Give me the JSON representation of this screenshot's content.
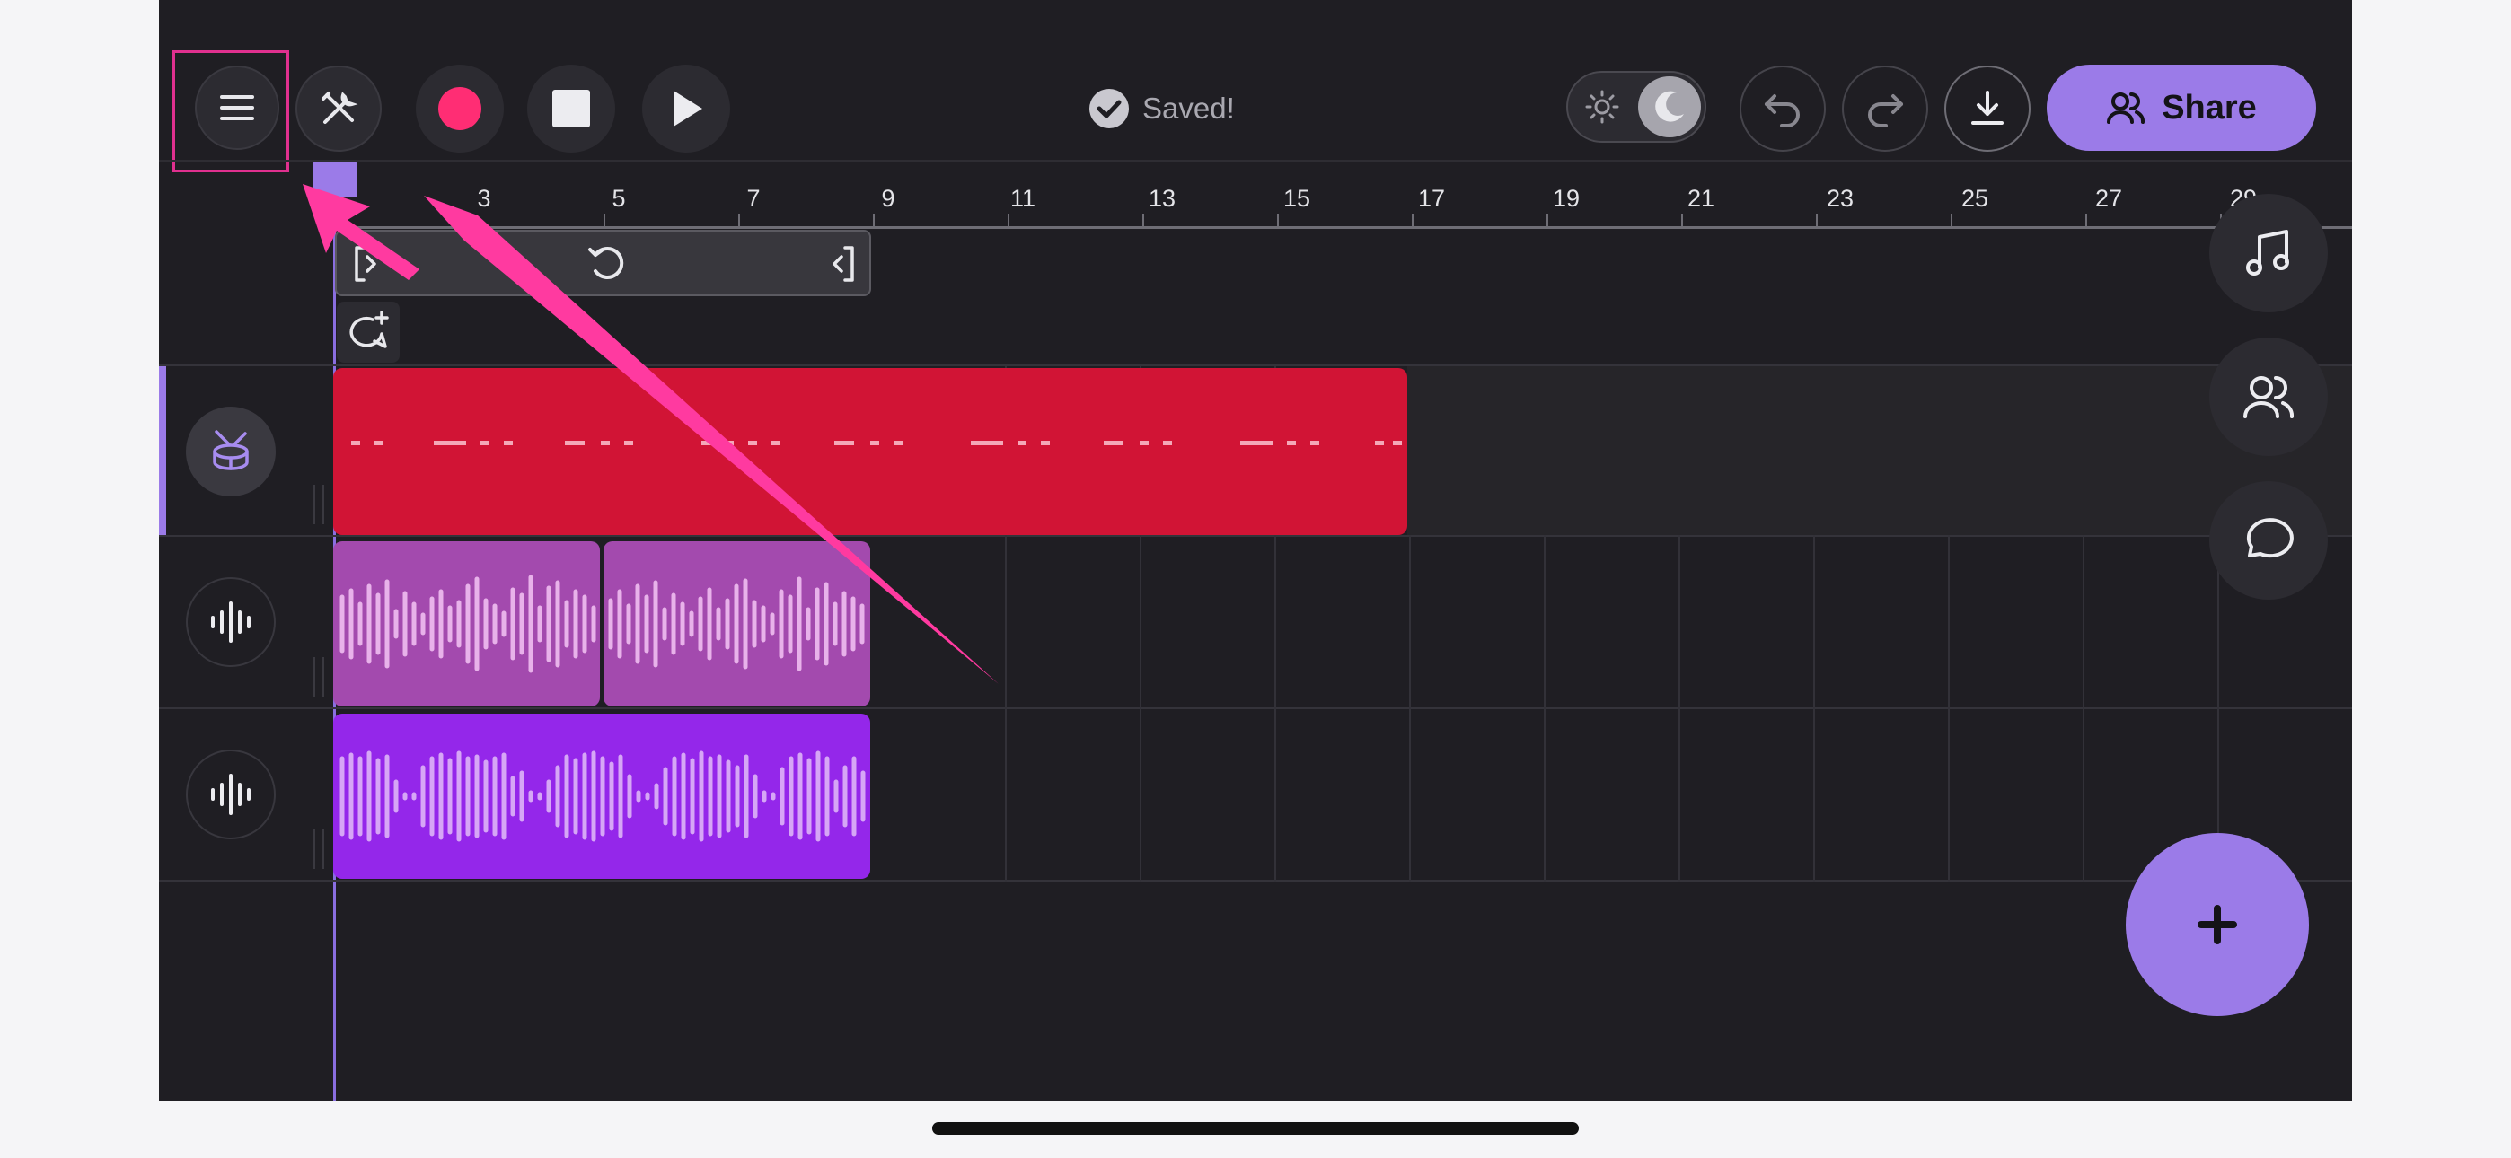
{
  "toolbar": {
    "menu_icon": "hamburger-menu-icon",
    "tools_icon": "tools-icon",
    "record_icon": "record-icon",
    "stop_icon": "stop-icon",
    "play_icon": "play-icon",
    "status": "Saved!",
    "theme_toggle": {
      "light_icon": "sun-icon",
      "dark_icon": "moon-icon",
      "selected": "dark"
    },
    "undo_icon": "undo-icon",
    "redo_icon": "redo-icon",
    "download_icon": "download-icon",
    "share_label": "Share",
    "share_icon": "users-icon"
  },
  "ruler": {
    "ticks": [
      "3",
      "5",
      "7",
      "9",
      "11",
      "13",
      "15",
      "17",
      "19",
      "21",
      "23",
      "25",
      "27",
      "29"
    ]
  },
  "loop_bar": {
    "start_icon": "loop-start-icon",
    "loop_icon": "loop-icon",
    "end_icon": "loop-end-icon"
  },
  "comment_add_icon": "add-comment-icon",
  "tracks": [
    {
      "type": "drums",
      "icon": "drum-icon",
      "clip_color": "#d11435",
      "selected": true
    },
    {
      "type": "audio",
      "icon": "waveform-icon",
      "clip_color": "#a34aae"
    },
    {
      "type": "audio",
      "icon": "waveform-icon",
      "clip_color": "#9427ea"
    }
  ],
  "side_panel": {
    "music_icon": "music-note-icon",
    "collab_icon": "users-icon",
    "chat_icon": "chat-icon"
  },
  "add_button_icon": "plus-icon",
  "colors": {
    "accent": "#9b7be8",
    "background": "#1f1e23",
    "record": "#ff2d74",
    "annotation": "#ff3aa0"
  }
}
